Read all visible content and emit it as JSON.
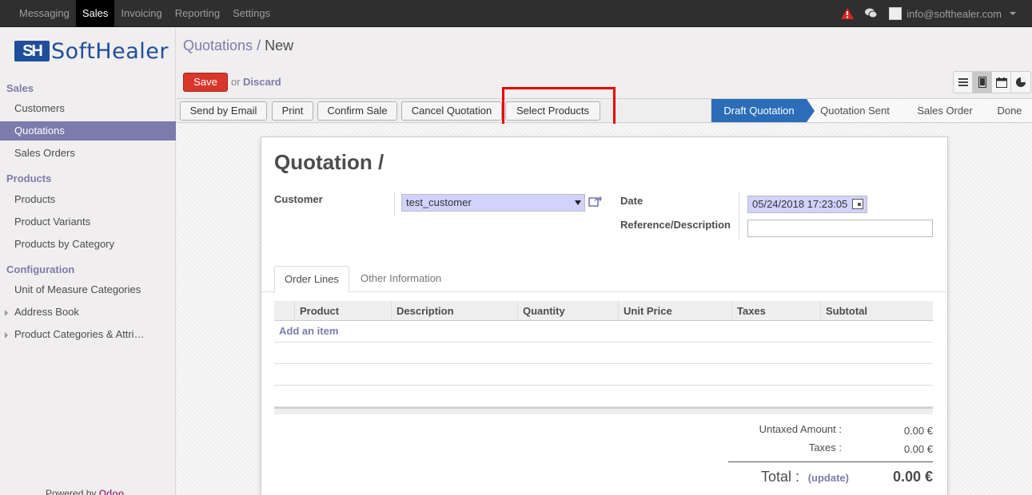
{
  "topbar": {
    "menus": [
      "Messaging",
      "Sales",
      "Invoicing",
      "Reporting",
      "Settings"
    ],
    "active_menu": "Sales",
    "user_email": "info@softhealer.com"
  },
  "sidebar": {
    "logo_mark": "SH",
    "logo_text": "SoftHealer",
    "sections": [
      {
        "title": "Sales",
        "items": [
          "Customers",
          "Quotations",
          "Sales Orders"
        ]
      },
      {
        "title": "Products",
        "items": [
          "Products",
          "Product Variants",
          "Products by Category"
        ]
      },
      {
        "title": "Configuration",
        "items": [
          "Unit of Measure Categories",
          "Address Book",
          "Product Categories & Attri…"
        ]
      }
    ],
    "active_item": "Quotations",
    "powered_by": "Powered by",
    "powered_brand": "Odoo"
  },
  "breadcrumb": {
    "parent": "Quotations",
    "separator": "/",
    "current": "New"
  },
  "actions": {
    "save": "Save",
    "or": "or",
    "discard": "Discard"
  },
  "header_buttons": [
    "Send by Email",
    "Print",
    "Confirm Sale",
    "Cancel Quotation",
    "Select Products"
  ],
  "statusbar": {
    "steps": [
      "Draft Quotation",
      "Quotation Sent",
      "Sales Order",
      "Done"
    ],
    "active": "Draft Quotation"
  },
  "form": {
    "title": "Quotation /",
    "customer_label": "Customer",
    "customer_value": "test_customer",
    "date_label": "Date",
    "date_value": "05/24/2018 17:23:05",
    "reference_label": "Reference/Description",
    "reference_value": ""
  },
  "tabs": [
    "Order Lines",
    "Other Information"
  ],
  "order_lines": {
    "columns": [
      "Product",
      "Description",
      "Quantity",
      "Unit Price",
      "Taxes",
      "Subtotal"
    ],
    "add_item": "Add an item"
  },
  "totals": {
    "untaxed_label": "Untaxed Amount :",
    "untaxed_value": "0.00 €",
    "taxes_label": "Taxes :",
    "taxes_value": "0.00 €",
    "total_label": "Total :",
    "update_link": "(update)",
    "total_value": "0.00 €"
  },
  "colors": {
    "accent": "#7c7bad",
    "primary": "#2b6db8",
    "save": "#d9362c",
    "highlight": "#ea0000"
  }
}
